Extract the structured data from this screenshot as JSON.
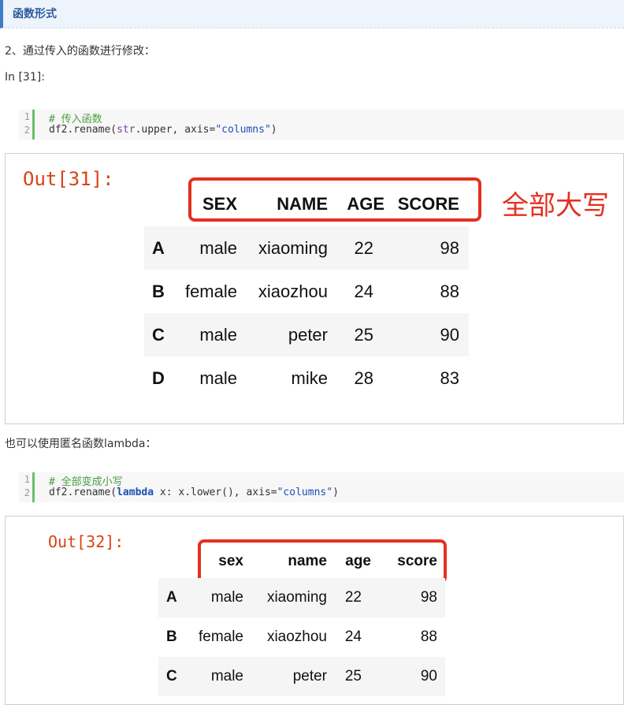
{
  "section": {
    "title": "函数形式"
  },
  "paragraph1": "2、通过传入的函数进行修改：",
  "in_prompt": "In [31]:",
  "code1": {
    "line_numbers": [
      "1",
      "2"
    ],
    "comment": "# 传入函数",
    "line2_a": "df2.rename(",
    "line2_builtin": "str",
    "line2_b": ".upper, axis=",
    "line2_str": "\"columns\"",
    "line2_c": ")"
  },
  "out1": {
    "label": "Out[31]:",
    "annotation": "全部大写",
    "columns": [
      "SEX",
      "NAME",
      "AGE",
      "SCORE"
    ],
    "rows": [
      {
        "index": "A",
        "values": [
          "male",
          "xiaoming",
          "22",
          "98"
        ]
      },
      {
        "index": "B",
        "values": [
          "female",
          "xiaozhou",
          "24",
          "88"
        ]
      },
      {
        "index": "C",
        "values": [
          "male",
          "peter",
          "25",
          "90"
        ]
      },
      {
        "index": "D",
        "values": [
          "male",
          "mike",
          "28",
          "83"
        ]
      }
    ]
  },
  "paragraph2": "也可以使用匿名函数lambda：",
  "code2": {
    "line_numbers": [
      "1",
      "2"
    ],
    "comment": "# 全部变成小写",
    "line2_a": "df2.rename(",
    "line2_kw": "lambda",
    "line2_b": " x: x.lower(), axis=",
    "line2_str": "\"columns\"",
    "line2_c": ")"
  },
  "out2": {
    "label": "Out[32]:",
    "columns": [
      "sex",
      "name",
      "age",
      "score"
    ],
    "rows": [
      {
        "index": "A",
        "values": [
          "male",
          "xiaoming",
          "22",
          "98"
        ]
      },
      {
        "index": "B",
        "values": [
          "female",
          "xiaozhou",
          "24",
          "88"
        ]
      },
      {
        "index": "C",
        "values": [
          "male",
          "peter",
          "25",
          "90"
        ]
      }
    ]
  },
  "colors": {
    "accent_red": "#e53020",
    "header_blue": "#2b5a9a",
    "comment_green": "#4a9e40"
  }
}
